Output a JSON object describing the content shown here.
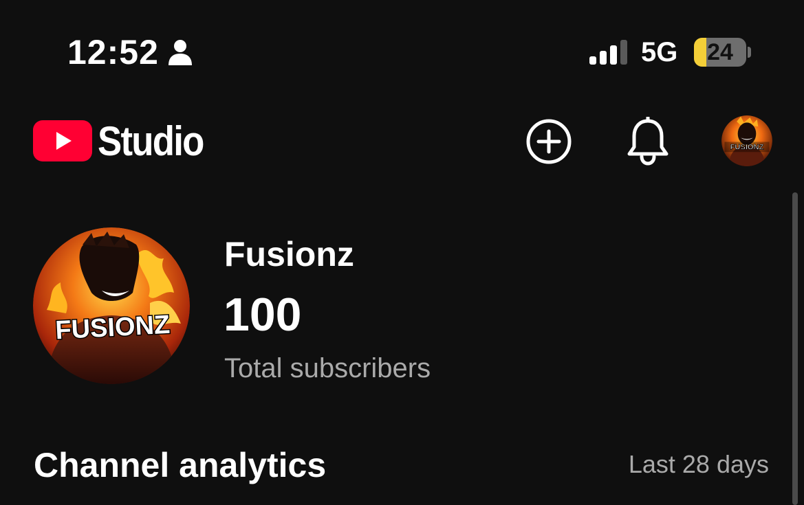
{
  "status_bar": {
    "time": "12:52",
    "person_icon": "person-icon",
    "signal_bars_active": 3,
    "signal_bars_total": 4,
    "network": "5G",
    "battery_percent": "24",
    "battery_level": 0.24
  },
  "header": {
    "logo_icon": "youtube-play-icon",
    "app_name": "Studio",
    "create_icon": "add-circle-icon",
    "notifications_icon": "bell-icon",
    "avatar_badge_text": "FUSIONZ"
  },
  "channel": {
    "name": "Fusionz",
    "subscriber_count": "100",
    "subscriber_label": "Total subscribers",
    "avatar_badge_text": "FUSIONZ"
  },
  "analytics": {
    "title": "Channel analytics",
    "range": "Last 28 days"
  },
  "colors": {
    "background": "#0f0f0f",
    "youtube_red": "#ff0033",
    "secondary_text": "#aaaaaa",
    "battery_yellow": "#f4cf38"
  }
}
